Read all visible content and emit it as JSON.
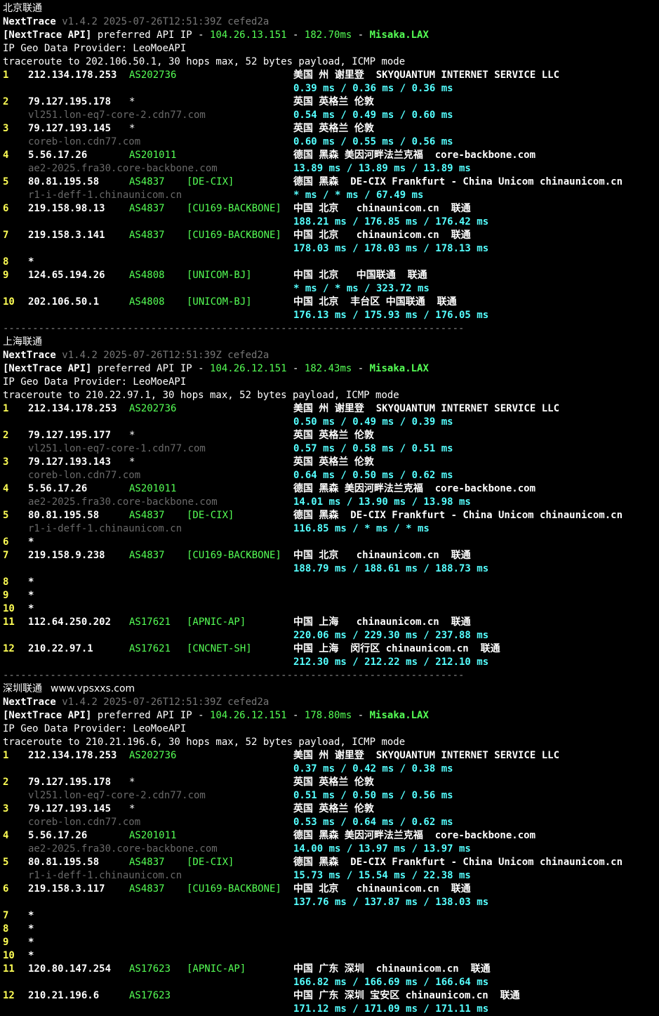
{
  "site": "www.vpsxxs.com",
  "sections": [
    {
      "title": "北京联通",
      "version_line": "v1.4.2 2025-07-26T12:51:39Z cefed2a",
      "api_ip": "104.26.13.151",
      "api_latency": "182.70ms",
      "api_node": "Misaka.LAX",
      "geo_provider": "IP Geo Data Provider: LeoMoeAPI",
      "traceroute": "traceroute to 202.106.50.1, 30 hops max, 52 bytes payload, ICMP mode",
      "hops": [
        {
          "n": "1",
          "ip": "212.134.178.253",
          "as": "AS202736",
          "tag": "",
          "geo": "美国 州 谢里登  SKYQUANTUM INTERNET SERVICE LLC",
          "host": "",
          "rtt": "0.39 ms / 0.36 ms / 0.36 ms"
        },
        {
          "n": "2",
          "ip": "79.127.195.178",
          "as": "*",
          "tag": "",
          "geo": "英国 英格兰 伦敦",
          "host": "vl251.lon-eq7-core-2.cdn77.com",
          "rtt": "0.54 ms / 0.49 ms / 0.60 ms"
        },
        {
          "n": "3",
          "ip": "79.127.193.145",
          "as": "*",
          "tag": "",
          "geo": "英国 英格兰 伦敦",
          "host": "coreb-lon.cdn77.com",
          "rtt": "0.60 ms / 0.55 ms / 0.56 ms"
        },
        {
          "n": "4",
          "ip": "5.56.17.26",
          "as": "AS201011",
          "tag": "",
          "geo": "德国 黑森 美因河畔法兰克福  core-backbone.com",
          "host": "ae2-2025.fra30.core-backbone.com",
          "rtt": "13.89 ms / 13.89 ms / 13.89 ms"
        },
        {
          "n": "5",
          "ip": "80.81.195.58",
          "as": "AS4837",
          "tag": "[DE-CIX]",
          "geo": "德国 黑森  DE-CIX Frankfurt - China Unicom chinaunicom.cn",
          "host": "r1-i-deff-1.chinaunicom.cn",
          "rtt": "* ms / * ms / 67.49 ms"
        },
        {
          "n": "6",
          "ip": "219.158.98.13",
          "as": "AS4837",
          "tag": "[CU169-BACKBONE]",
          "geo": "中国 北京   chinaunicom.cn  联通",
          "host": "",
          "rtt": "188.21 ms / 176.85 ms / 176.42 ms"
        },
        {
          "n": "7",
          "ip": "219.158.3.141",
          "as": "AS4837",
          "tag": "[CU169-BACKBONE]",
          "geo": "中国 北京   chinaunicom.cn  联通",
          "host": "",
          "rtt": "178.03 ms / 178.03 ms / 178.13 ms"
        },
        {
          "n": "8",
          "ip": "*",
          "as": "",
          "tag": "",
          "geo": "",
          "host": "",
          "rtt": ""
        },
        {
          "n": "9",
          "ip": "124.65.194.26",
          "as": "AS4808",
          "tag": "[UNICOM-BJ]",
          "geo": "中国 北京   中国联通  联通",
          "host": "",
          "rtt": "* ms / * ms / 323.72 ms"
        },
        {
          "n": "10",
          "ip": "202.106.50.1",
          "as": "AS4808",
          "tag": "[UNICOM-BJ]",
          "geo": "中国 北京  丰台区 中国联通  联通",
          "host": "",
          "rtt": "176.13 ms / 175.93 ms / 176.05 ms"
        }
      ]
    },
    {
      "title": "上海联通",
      "version_line": "v1.4.2 2025-07-26T12:51:39Z cefed2a",
      "api_ip": "104.26.12.151",
      "api_latency": "182.43ms",
      "api_node": "Misaka.LAX",
      "geo_provider": "IP Geo Data Provider: LeoMoeAPI",
      "traceroute": "traceroute to 210.22.97.1, 30 hops max, 52 bytes payload, ICMP mode",
      "hops": [
        {
          "n": "1",
          "ip": "212.134.178.253",
          "as": "AS202736",
          "tag": "",
          "geo": "美国 州 谢里登  SKYQUANTUM INTERNET SERVICE LLC",
          "host": "",
          "rtt": "0.50 ms / 0.49 ms / 0.39 ms"
        },
        {
          "n": "2",
          "ip": "79.127.195.177",
          "as": "*",
          "tag": "",
          "geo": "英国 英格兰 伦敦",
          "host": "vl251.lon-eq7-core-1.cdn77.com",
          "rtt": "0.57 ms / 0.58 ms / 0.51 ms"
        },
        {
          "n": "3",
          "ip": "79.127.193.143",
          "as": "*",
          "tag": "",
          "geo": "英国 英格兰 伦敦",
          "host": "coreb-lon.cdn77.com",
          "rtt": "0.64 ms / 0.50 ms / 0.62 ms"
        },
        {
          "n": "4",
          "ip": "5.56.17.26",
          "as": "AS201011",
          "tag": "",
          "geo": "德国 黑森 美因河畔法兰克福  core-backbone.com",
          "host": "ae2-2025.fra30.core-backbone.com",
          "rtt": "14.01 ms / 13.90 ms / 13.98 ms"
        },
        {
          "n": "5",
          "ip": "80.81.195.58",
          "as": "AS4837",
          "tag": "[DE-CIX]",
          "geo": "德国 黑森  DE-CIX Frankfurt - China Unicom chinaunicom.cn",
          "host": "r1-i-deff-1.chinaunicom.cn",
          "rtt": "116.85 ms / * ms / * ms"
        },
        {
          "n": "6",
          "ip": "*",
          "as": "",
          "tag": "",
          "geo": "",
          "host": "",
          "rtt": ""
        },
        {
          "n": "7",
          "ip": "219.158.9.238",
          "as": "AS4837",
          "tag": "[CU169-BACKBONE]",
          "geo": "中国 北京   chinaunicom.cn  联通",
          "host": "",
          "rtt": "188.79 ms / 188.61 ms / 188.73 ms"
        },
        {
          "n": "8",
          "ip": "*",
          "as": "",
          "tag": "",
          "geo": "",
          "host": "",
          "rtt": ""
        },
        {
          "n": "9",
          "ip": "*",
          "as": "",
          "tag": "",
          "geo": "",
          "host": "",
          "rtt": ""
        },
        {
          "n": "10",
          "ip": "*",
          "as": "",
          "tag": "",
          "geo": "",
          "host": "",
          "rtt": ""
        },
        {
          "n": "11",
          "ip": "112.64.250.202",
          "as": "AS17621",
          "tag": "[APNIC-AP]",
          "geo": "中国 上海   chinaunicom.cn  联通",
          "host": "",
          "rtt": "220.06 ms / 229.30 ms / 237.88 ms"
        },
        {
          "n": "12",
          "ip": "210.22.97.1",
          "as": "AS17621",
          "tag": "[CNCNET-SH]",
          "geo": "中国 上海  闵行区 chinaunicom.cn  联通",
          "host": "",
          "rtt": "212.30 ms / 212.22 ms / 212.10 ms"
        }
      ]
    },
    {
      "title": "深圳联通",
      "version_line": "v1.4.2 2025-07-26T12:51:39Z cefed2a",
      "api_ip": "104.26.12.151",
      "api_latency": "178.80ms",
      "api_node": "Misaka.LAX",
      "geo_provider": "IP Geo Data Provider: LeoMoeAPI",
      "traceroute": "traceroute to 210.21.196.6, 30 hops max, 52 bytes payload, ICMP mode",
      "hops": [
        {
          "n": "1",
          "ip": "212.134.178.253",
          "as": "AS202736",
          "tag": "",
          "geo": "美国 州 谢里登  SKYQUANTUM INTERNET SERVICE LLC",
          "host": "",
          "rtt": "0.37 ms / 0.42 ms / 0.38 ms"
        },
        {
          "n": "2",
          "ip": "79.127.195.178",
          "as": "*",
          "tag": "",
          "geo": "英国 英格兰 伦敦",
          "host": "vl251.lon-eq7-core-2.cdn77.com",
          "rtt": "0.51 ms / 0.50 ms / 0.56 ms"
        },
        {
          "n": "3",
          "ip": "79.127.193.145",
          "as": "*",
          "tag": "",
          "geo": "英国 英格兰 伦敦",
          "host": "coreb-lon.cdn77.com",
          "rtt": "0.53 ms / 0.64 ms / 0.62 ms"
        },
        {
          "n": "4",
          "ip": "5.56.17.26",
          "as": "AS201011",
          "tag": "",
          "geo": "德国 黑森 美因河畔法兰克福  core-backbone.com",
          "host": "ae2-2025.fra30.core-backbone.com",
          "rtt": "14.00 ms / 13.97 ms / 13.97 ms"
        },
        {
          "n": "5",
          "ip": "80.81.195.58",
          "as": "AS4837",
          "tag": "[DE-CIX]",
          "geo": "德国 黑森  DE-CIX Frankfurt - China Unicom chinaunicom.cn",
          "host": "r1-i-deff-1.chinaunicom.cn",
          "rtt": "15.73 ms / 15.54 ms / 22.38 ms"
        },
        {
          "n": "6",
          "ip": "219.158.3.117",
          "as": "AS4837",
          "tag": "[CU169-BACKBONE]",
          "geo": "中国 北京   chinaunicom.cn  联通",
          "host": "",
          "rtt": "137.76 ms / 137.87 ms / 138.03 ms"
        },
        {
          "n": "7",
          "ip": "*",
          "as": "",
          "tag": "",
          "geo": "",
          "host": "",
          "rtt": ""
        },
        {
          "n": "8",
          "ip": "*",
          "as": "",
          "tag": "",
          "geo": "",
          "host": "",
          "rtt": ""
        },
        {
          "n": "9",
          "ip": "*",
          "as": "",
          "tag": "",
          "geo": "",
          "host": "",
          "rtt": ""
        },
        {
          "n": "10",
          "ip": "*",
          "as": "",
          "tag": "",
          "geo": "",
          "host": "",
          "rtt": ""
        },
        {
          "n": "11",
          "ip": "120.80.147.254",
          "as": "AS17623",
          "tag": "[APNIC-AP]",
          "geo": "中国 广东 深圳  chinaunicom.cn  联通",
          "host": "",
          "rtt": "166.82 ms / 166.69 ms / 166.64 ms"
        },
        {
          "n": "12",
          "ip": "210.21.196.6",
          "as": "AS17623",
          "tag": "",
          "geo": "中国 广东 深圳 宝安区 chinaunicom.cn  联通",
          "host": "",
          "rtt": "171.12 ms / 171.09 ms / 171.11 ms"
        }
      ]
    }
  ],
  "separator": "------------------------------------------------------------------------------"
}
